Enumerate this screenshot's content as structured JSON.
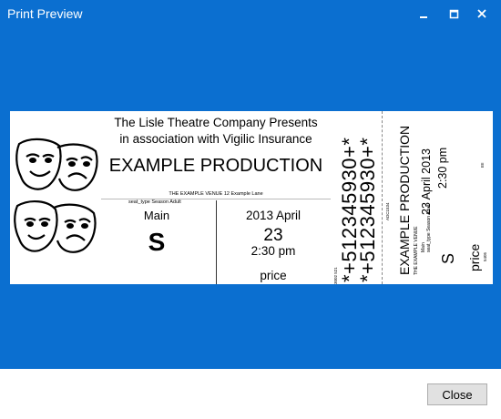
{
  "window": {
    "title": "Print Preview",
    "controls": [
      "minimize",
      "maximize",
      "close"
    ]
  },
  "ticket": {
    "presenter_line1": "The Lisle Theatre Company Presents",
    "presenter_line2": "in association with Vigilic Insurance",
    "production": "EXAMPLE PRODUCTION",
    "venue": "THE EXAMPLE VENUE  12 Example Lane",
    "seat_type": "seat_type Season Adult",
    "section": "Main",
    "seat": "S",
    "date": "2013 April",
    "day": "23",
    "time": "2:30 pm",
    "price": "price",
    "barcode_text": "*+512345930+*",
    "code_small_left": "3002 521",
    "code_mid": "ADC1534",
    "stub_production": "EXAMPLE PRODUCTION",
    "stub_venue": "THE EXAMPLE VENUE",
    "stub_section": "Main",
    "stub_seat_type": "seat_type Season Adult",
    "stub_date": "23 April 2013",
    "stub_time": "2:30 pm",
    "stub_seat": "S",
    "stub_price": "price",
    "stub_code_top": "EII",
    "stub_code_bottom": "5405"
  },
  "footer": {
    "close_label": "Close"
  }
}
